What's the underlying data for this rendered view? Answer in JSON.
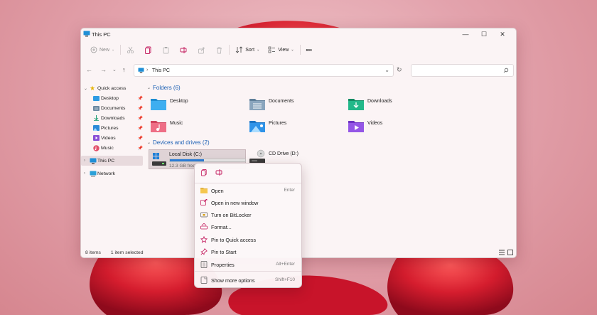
{
  "window": {
    "title": "This PC",
    "controls": {
      "minimize": "—",
      "maximize": "☐",
      "close": "✕"
    }
  },
  "toolbar": {
    "new_label": "New",
    "sort_label": "Sort",
    "view_label": "View",
    "more_label": "•••"
  },
  "address": {
    "path": "This PC",
    "separator": "›",
    "search_placeholder": ""
  },
  "sidebar": {
    "quick_access": "Quick access",
    "items": [
      {
        "label": "Desktop",
        "icon": "desktop-folder-icon"
      },
      {
        "label": "Documents",
        "icon": "documents-folder-icon"
      },
      {
        "label": "Downloads",
        "icon": "downloads-folder-icon"
      },
      {
        "label": "Pictures",
        "icon": "pictures-folder-icon"
      },
      {
        "label": "Videos",
        "icon": "videos-folder-icon"
      },
      {
        "label": "Music",
        "icon": "music-folder-icon"
      }
    ],
    "this_pc": "This PC",
    "network": "Network"
  },
  "main": {
    "folders_header": "Folders (6)",
    "folders": [
      {
        "label": "Desktop"
      },
      {
        "label": "Documents"
      },
      {
        "label": "Downloads"
      },
      {
        "label": "Music"
      },
      {
        "label": "Pictures"
      },
      {
        "label": "Videos"
      }
    ],
    "drives_header": "Devices and drives (2)",
    "local_disk": {
      "name": "Local Disk (C:)",
      "free": "12.3 GB free",
      "used_fraction": 0.45
    },
    "cd_drive": {
      "name": "CD Drive (D:)"
    }
  },
  "status": {
    "items": "8 items",
    "selected": "1 item selected"
  },
  "context_menu": {
    "items": [
      {
        "label": "Open",
        "shortcut": "Enter"
      },
      {
        "label": "Open in new window",
        "shortcut": ""
      },
      {
        "label": "Turn on BitLocker",
        "shortcut": ""
      },
      {
        "label": "Format...",
        "shortcut": ""
      },
      {
        "label": "Pin to Quick access",
        "shortcut": ""
      },
      {
        "label": "Pin to Start",
        "shortcut": ""
      },
      {
        "label": "Properties",
        "shortcut": "Alt+Enter"
      },
      {
        "label": "Show more options",
        "shortcut": "Shift+F10"
      }
    ]
  },
  "colors": {
    "accent": "#1a5fb4",
    "drive_bar": "#2b7bd6",
    "ctx_icon": "#c2185b"
  }
}
